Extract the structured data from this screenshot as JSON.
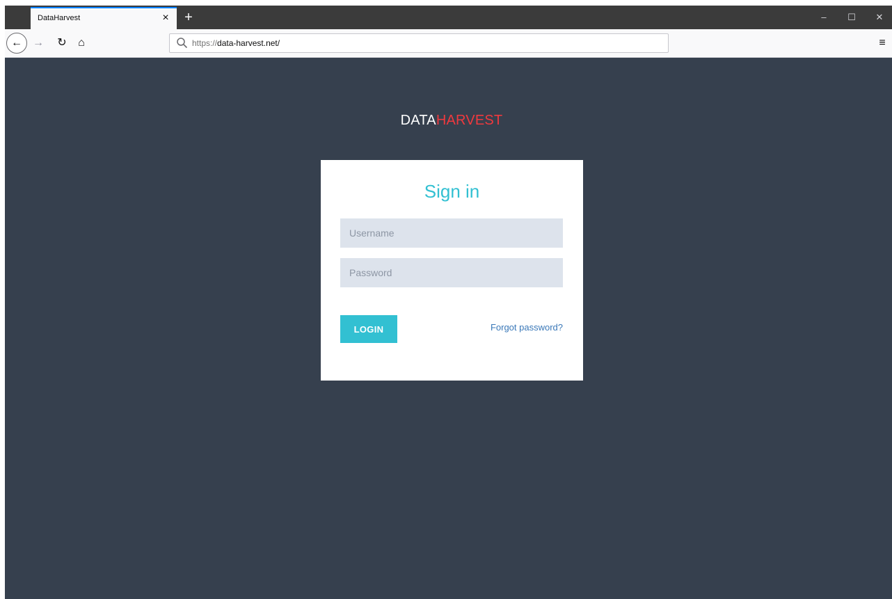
{
  "browser": {
    "tab": {
      "title": "DataHarvest",
      "close_glyph": "×"
    },
    "new_tab_glyph": "+",
    "window_controls": {
      "minimize": "–",
      "maximize": "☐",
      "close": "✕"
    },
    "toolbar": {
      "back_glyph": "←",
      "forward_glyph": "→",
      "reload_glyph": "↻",
      "home_glyph": "⌂",
      "menu_glyph": "≡"
    },
    "urlbar": {
      "scheme": "https://",
      "host_path": "data-harvest.net/"
    }
  },
  "page": {
    "brand": {
      "part1": "DATA",
      "part2": "HARVEST"
    },
    "signin": {
      "title": "Sign in",
      "username_placeholder": "Username",
      "password_placeholder": "Password",
      "login_label": "LOGIN",
      "forgot_label": "Forgot password?"
    }
  },
  "colors": {
    "page_background": "#36404e",
    "accent": "#32c0d2",
    "brand_red": "#f0393e",
    "link": "#3a78b8",
    "input_background": "#dde3ec"
  },
  "icons": {
    "back": "back-arrow-icon",
    "forward": "forward-arrow-icon",
    "reload": "reload-icon",
    "home": "home-icon",
    "search": "search-icon",
    "menu": "hamburger-menu-icon"
  }
}
